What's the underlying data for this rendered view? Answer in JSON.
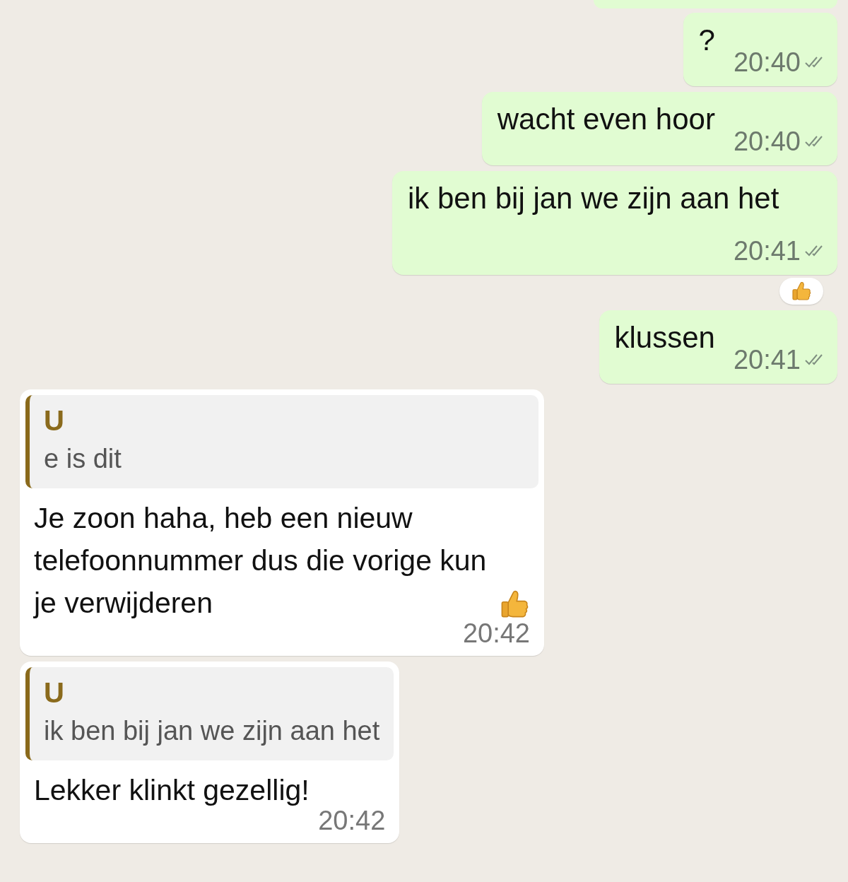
{
  "messages": [
    {
      "kind": "outgoing",
      "text": "?",
      "time": "20:40",
      "read": false,
      "reacted": false
    },
    {
      "kind": "outgoing",
      "text": "wacht even hoor",
      "time": "20:40",
      "read": false,
      "reacted": false
    },
    {
      "kind": "outgoing",
      "text": "ik ben bij jan we zijn aan het",
      "time": "20:41",
      "read": false,
      "reacted": true
    },
    {
      "kind": "outgoing",
      "text": "klussen",
      "time": "20:41",
      "read": false,
      "reacted": false
    },
    {
      "kind": "incoming",
      "quote": {
        "author": "U",
        "text": "e is dit"
      },
      "text": "Je zoon haha, heb een nieuw telefoonnummer dus die vorige kun je verwijderen",
      "has_emoji": true,
      "time": "20:42"
    },
    {
      "kind": "incoming",
      "quote": {
        "author": "U",
        "text": "ik ben bij jan we zijn aan het"
      },
      "text": "Lekker klinkt gezellig!",
      "has_emoji": false,
      "time": "20:42"
    }
  ]
}
